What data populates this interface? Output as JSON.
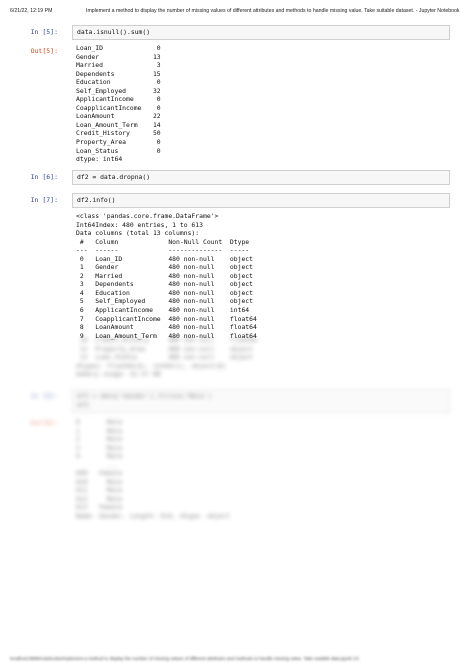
{
  "header": {
    "date": "6/21/22, 12:19 PM",
    "title": "Implement a method to display the number of missing values of different attributes and methods to handle missing value. Take suitable dataset. - Jupyter Notebook"
  },
  "cells": {
    "c5": {
      "in_prompt": "In [5]:",
      "code": "data.isnull().sum()",
      "out_prompt": "Out[5]:",
      "output": "Loan_ID              0\nGender              13\nMarried              3\nDependents          15\nEducation            0\nSelf_Employed       32\nApplicantIncome      0\nCoapplicantIncome    0\nLoanAmount          22\nLoan_Amount_Term    14\nCredit_History      50\nProperty_Area        0\nLoan_Status          0\ndtype: int64"
    },
    "c6": {
      "in_prompt": "In [6]:",
      "code": "df2 = data.dropna()"
    },
    "c7": {
      "in_prompt": "In [7]:",
      "code": "df2.info()",
      "output": "<class 'pandas.core.frame.DataFrame'>\nInt64Index: 480 entries, 1 to 613\nData columns (total 13 columns):\n #   Column             Non-Null Count  Dtype\n---  ------             --------------  -----\n 0   Loan_ID            480 non-null    object\n 1   Gender             480 non-null    object\n 2   Married            480 non-null    object\n 3   Dependents         480 non-null    object\n 4   Education          480 non-null    object\n 5   Self_Employed      480 non-null    object\n 6   ApplicantIncome    480 non-null    int64\n 7   CoapplicantIncome  480 non-null    float64\n 8   LoanAmount         480 non-null    float64\n 9   Loan_Amount_Term   480 non-null    float64",
      "blurred_output": " 10  Credit_History     480 non-null    float64\n 11  Property_Area      480 non-null    object\n 12  Loan_Status        480 non-null    object\ndtypes: float64(4), int64(1), object(8)\nmemory usage: 52.5+ KB"
    },
    "c8": {
      "in_prompt": "In [8]:",
      "code": "df3 = data['Gender'].fillna('Male')\ndf3",
      "out_prompt": "Out[8]:",
      "output": "0       Male\n1       Male\n2       Male\n3       Male\n4       Male\n        ...\n609   Female\n610     Male\n611     Male\n612     Male\n613   Female\nName: Gender, Length: 614, dtype: object"
    }
  },
  "footer": {
    "text": "localhost:8888/notebooks/Implement a method to display the number of missing values of different attributes and methods to handle missing value. Take suitable data.ipynb      1/1"
  }
}
